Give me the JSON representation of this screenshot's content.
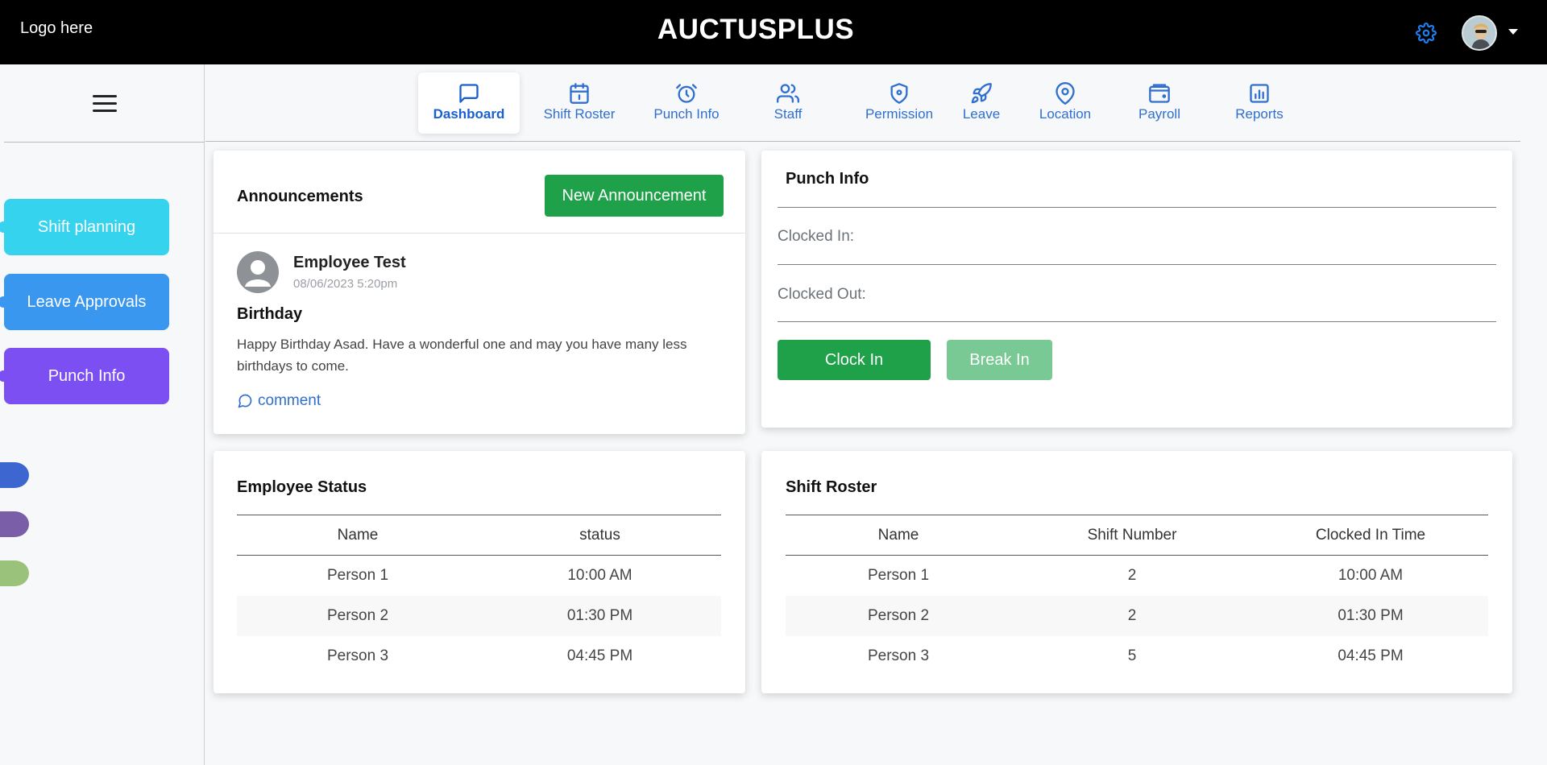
{
  "header": {
    "logo_text": "Logo here",
    "app_title": "AUCTUSPLUS",
    "settings_icon": "gear-icon",
    "profile_icon": "avatar"
  },
  "sidebar": {
    "menu_icon": "hamburger-icon",
    "buttons": [
      {
        "label": "Shift planning",
        "color": "#35d3ee"
      },
      {
        "label": "Leave Approvals",
        "color": "#3a97ef"
      },
      {
        "label": "Punch Info",
        "color": "#7c4ff2"
      }
    ],
    "dot_colors": [
      "#3d66d1",
      "#7b5ea8",
      "#9ac27a"
    ]
  },
  "nav": {
    "active": "Dashboard",
    "tabs": [
      {
        "label": "Dashboard",
        "icon": "presentation-icon"
      },
      {
        "label": "Shift Roster",
        "icon": "calendar-icon"
      },
      {
        "label": "Punch Info",
        "icon": "alarm-clock-icon"
      },
      {
        "label": "Staff",
        "icon": "people-icon"
      },
      {
        "label": "Permission",
        "icon": "shield-icon"
      },
      {
        "label": "Leave",
        "icon": "rocket-icon"
      },
      {
        "label": "Location",
        "icon": "map-pin-icon"
      },
      {
        "label": "Payroll",
        "icon": "wallet-icon"
      },
      {
        "label": "Reports",
        "icon": "bar-chart-icon"
      }
    ]
  },
  "announcements": {
    "title": "Announcements",
    "new_button": "New Announcement",
    "post": {
      "author": "Employee Test",
      "timestamp": "08/06/2023 5:20pm",
      "heading": "Birthday",
      "body": "Happy Birthday Asad. Have a wonderful one and may you have many less birthdays to come.",
      "comment_label": "comment"
    }
  },
  "punch_info": {
    "title": "Punch Info",
    "clocked_in_label": "Clocked In:",
    "clocked_out_label": "Clocked Out:",
    "clock_in_button": "Clock In",
    "break_in_button": "Break In"
  },
  "employee_status": {
    "title": "Employee Status",
    "columns": [
      "Name",
      "status"
    ],
    "rows": [
      [
        "Person 1",
        "10:00 AM"
      ],
      [
        "Person 2",
        "01:30 PM"
      ],
      [
        "Person 3",
        "04:45 PM"
      ]
    ]
  },
  "shift_roster": {
    "title": "Shift Roster",
    "columns": [
      "Name",
      "Shift Number",
      "Clocked In Time"
    ],
    "rows": [
      [
        "Person 1",
        "2",
        "10:00 AM"
      ],
      [
        "Person 2",
        "2",
        "01:30 PM"
      ],
      [
        "Person 3",
        "5",
        "04:45 PM"
      ]
    ]
  }
}
